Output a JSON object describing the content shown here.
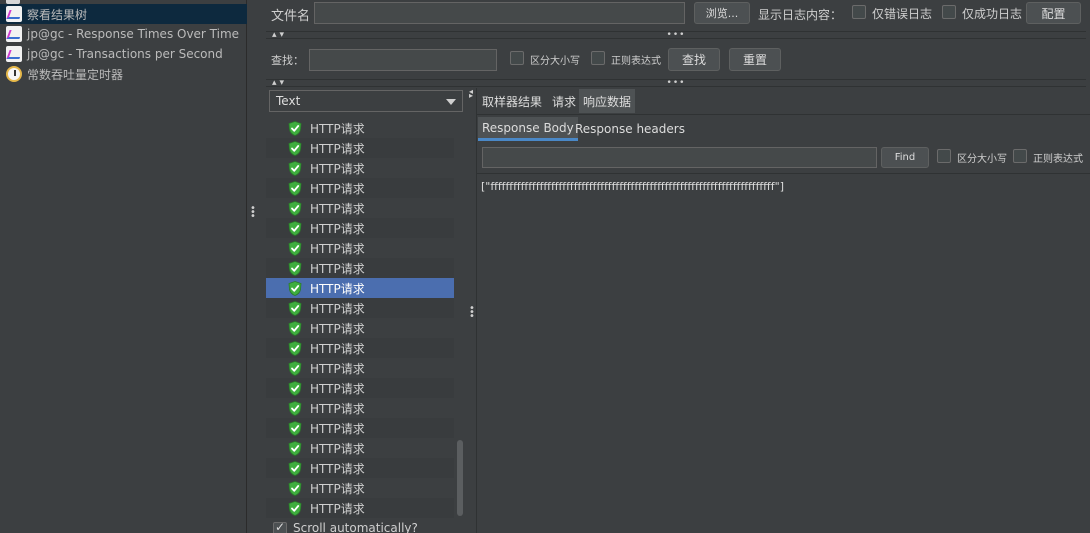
{
  "tree": {
    "items": [
      {
        "label": "察看结果树",
        "icon": "graph-icon",
        "selected": true
      },
      {
        "label": "jp@gc - Response Times Over Time",
        "icon": "graph-icon"
      },
      {
        "label": "jp@gc - Transactions per Second",
        "icon": "graph-icon"
      },
      {
        "label": "常数吞吐量定时器",
        "icon": "timer-icon"
      }
    ]
  },
  "file_bar": {
    "filename_label": "文件名",
    "filename_value": "",
    "browse_label": "浏览...",
    "log_display_label": "显示日志内容：",
    "errors_only_label": "仅错误日志",
    "success_only_label": "仅成功日志",
    "configure_label": "配置"
  },
  "search_bar": {
    "search_label": "查找：",
    "search_value": "",
    "case_sensitive_label": "区分大小写",
    "regex_label": "正则表达式",
    "find_label": "查找",
    "reset_label": "重置"
  },
  "results": {
    "renderer_selected": "Text",
    "rows": [
      "HTTP请求",
      "HTTP请求",
      "HTTP请求",
      "HTTP请求",
      "HTTP请求",
      "HTTP请求",
      "HTTP请求",
      "HTTP请求",
      "HTTP请求",
      "HTTP请求",
      "HTTP请求",
      "HTTP请求",
      "HTTP请求",
      "HTTP请求",
      "HTTP请求",
      "HTTP请求",
      "HTTP请求",
      "HTTP请求",
      "HTTP请求",
      "HTTP请求"
    ],
    "selected_index": 8,
    "scroll_auto_label": "Scroll automatically?"
  },
  "detail": {
    "tabs": [
      "取样器结果",
      "请求",
      "响应数据"
    ],
    "active_tab": 2,
    "sub_tabs": [
      "Response Body",
      "Response headers"
    ],
    "active_sub_tab": 0,
    "find_value": "",
    "find_label": "Find",
    "case_sensitive_label": "区分大小写",
    "regex_label": "正则表达式",
    "response_body": "[\"fffffffffffffffffffffffffffffffffffffffffffffffffffffffffffffffffffffffffff\"]"
  },
  "colors": {
    "background": "#3c3f41",
    "selection": "#4b6eaf",
    "success_green": "#3fae3f"
  }
}
